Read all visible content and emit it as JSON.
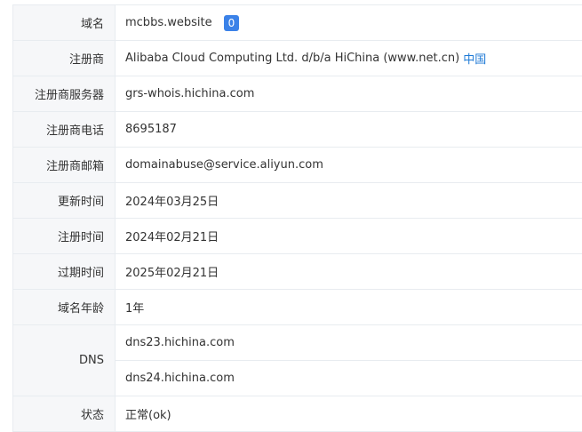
{
  "rows": {
    "domain": {
      "label": "域名",
      "value": "mcbbs.website",
      "badge": "0"
    },
    "registrar": {
      "label": "注册商",
      "value": "Alibaba Cloud Computing Ltd. d/b/a HiChina (www.net.cn)",
      "link": "中国"
    },
    "registrar_server": {
      "label": "注册商服务器",
      "value": "grs-whois.hichina.com"
    },
    "registrar_phone": {
      "label": "注册商电话",
      "value": "8695187"
    },
    "registrar_email": {
      "label": "注册商邮箱",
      "value": "domainabuse@service.aliyun.com"
    },
    "updated": {
      "label": "更新时间",
      "value": "2024年03月25日"
    },
    "registered": {
      "label": "注册时间",
      "value": "2024年02月21日"
    },
    "expires": {
      "label": "过期时间",
      "value": "2025年02月21日"
    },
    "age": {
      "label": "域名年龄",
      "value": "1年"
    },
    "dns": {
      "label": "DNS",
      "values": [
        "dns23.hichina.com",
        "dns24.hichina.com"
      ]
    },
    "status": {
      "label": "状态",
      "value": "正常(ok)"
    }
  }
}
